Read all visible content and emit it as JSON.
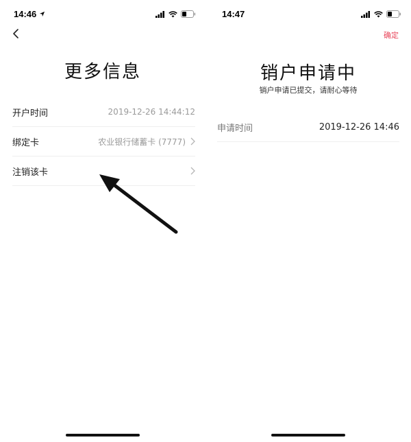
{
  "left_screen": {
    "status_time": "14:46",
    "title": "更多信息",
    "rows": [
      {
        "label": "开户时间",
        "value": "2019-12-26 14:44:12"
      },
      {
        "label": "绑定卡",
        "value": "农业银行储蓄卡 (7777)"
      },
      {
        "label": "注销该卡",
        "value": ""
      }
    ]
  },
  "right_screen": {
    "status_time": "14:47",
    "confirm_label": "确定",
    "title": "销户申请中",
    "subtitle": "销户申请已提交，请耐心等待",
    "rows": [
      {
        "label": "申请时间",
        "value": "2019-12-26 14:46"
      }
    ]
  },
  "colors": {
    "accent": "#e8455a",
    "annotation_arrow": "#111111"
  },
  "icons": [
    "location-arrow-icon",
    "signal-icon",
    "wifi-icon",
    "battery-icon",
    "back-chevron-icon",
    "chevron-right-icon",
    "annotation-arrow"
  ]
}
